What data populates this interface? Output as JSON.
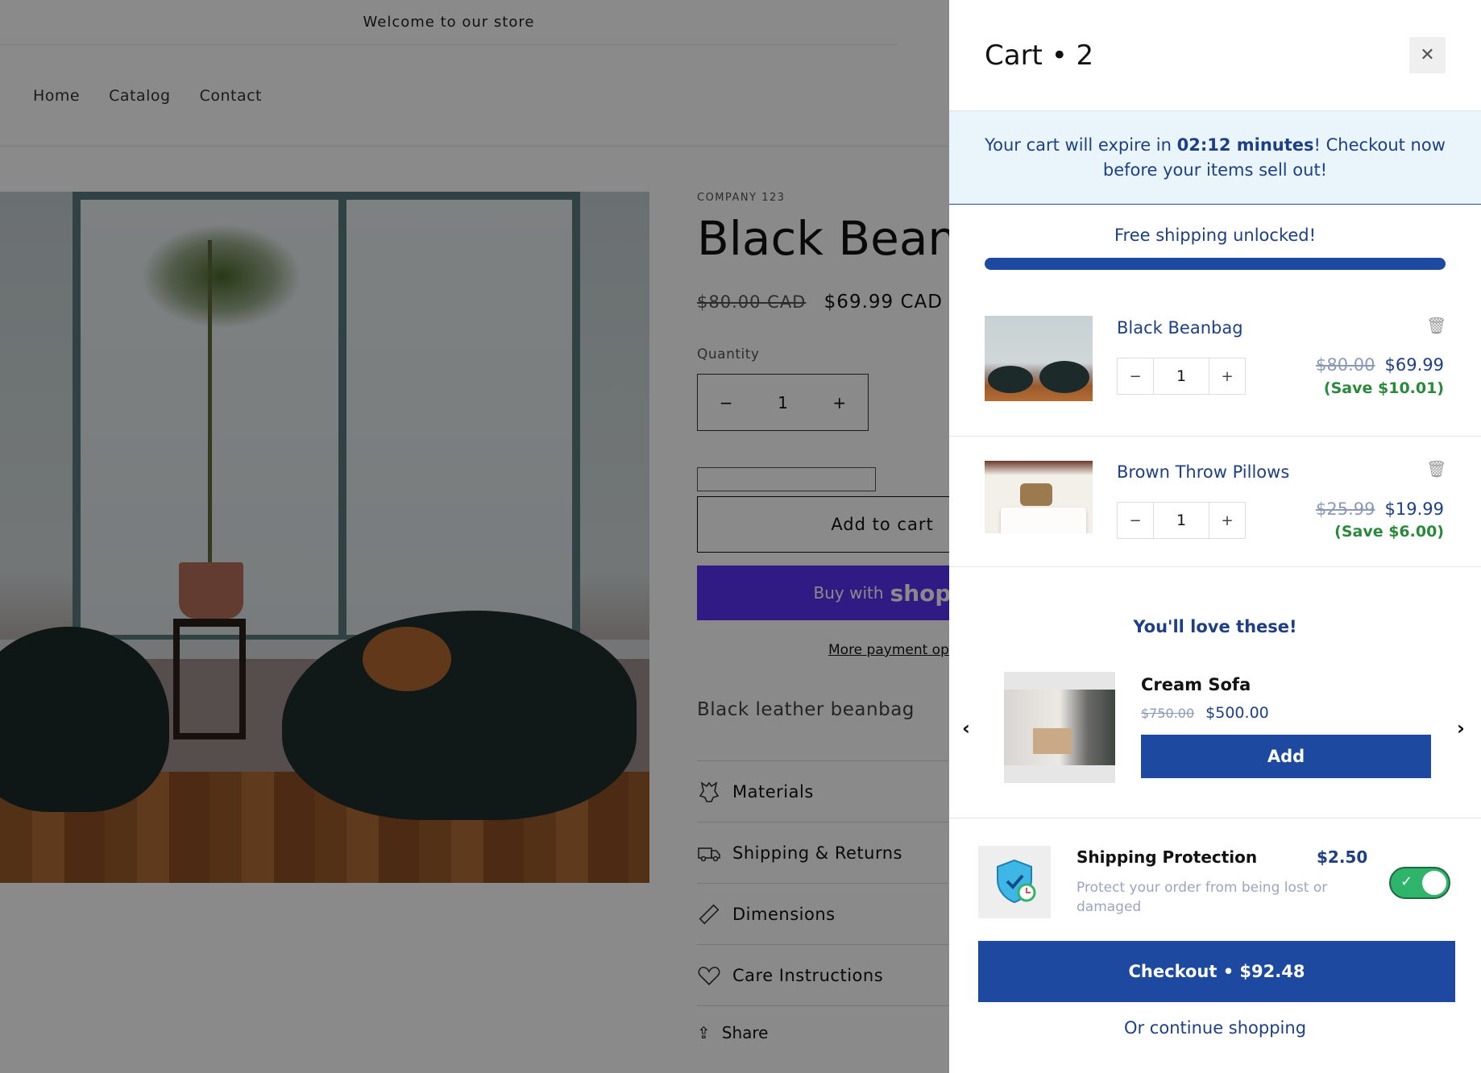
{
  "store": {
    "announcement": "Welcome to our store",
    "nav": [
      "Home",
      "Catalog",
      "Contact"
    ],
    "product": {
      "vendor": "COMPANY 123",
      "title": "Black Beanbag",
      "price_old": "$80.00 CAD",
      "price_new": "$69.99 CAD",
      "quantity_label": "Quantity",
      "quantity": "1",
      "add_to_cart": "Add to cart",
      "buy_with": "Buy with",
      "buy_with_brand": "shop",
      "more_payment": "More payment options",
      "description": "Black leather beanbag",
      "accordions": [
        "Materials",
        "Shipping & Returns",
        "Dimensions",
        "Care Instructions"
      ],
      "share": "Share"
    }
  },
  "cart": {
    "title": "Cart • 2",
    "timer": {
      "prefix": "Your cart will expire in ",
      "time": "02:12 minutes",
      "suffix": "! Checkout now before your items sell out!"
    },
    "shipping_message": "Free shipping unlocked!",
    "shipping_progress": 1.0,
    "items": [
      {
        "name": "Black Beanbag",
        "qty": "1",
        "price_old": "$80.00",
        "price_new": "$69.99",
        "save": "(Save $10.01)"
      },
      {
        "name": "Brown Throw Pillows",
        "qty": "1",
        "price_old": "$25.99",
        "price_new": "$19.99",
        "save": "(Save $6.00)"
      }
    ],
    "recommendations": {
      "title": "You'll love these!",
      "item": {
        "name": "Cream Sofa",
        "price_old": "$750.00",
        "price_new": "$500.00",
        "button": "Add"
      }
    },
    "protection": {
      "title": "Shipping Protection",
      "price": "$2.50",
      "description": "Protect your order from being lost or damaged",
      "enabled": true
    },
    "checkout_button": "Checkout • $92.48",
    "continue_link": "Or continue shopping"
  },
  "colors": {
    "accent": "#1d4aa0",
    "accent_text": "#1d3f86",
    "save_green": "#2a8a3c",
    "timer_bg": "#e9f5fb",
    "toggle_on": "#2fb46b",
    "shop_purple": "#5a31f4"
  }
}
